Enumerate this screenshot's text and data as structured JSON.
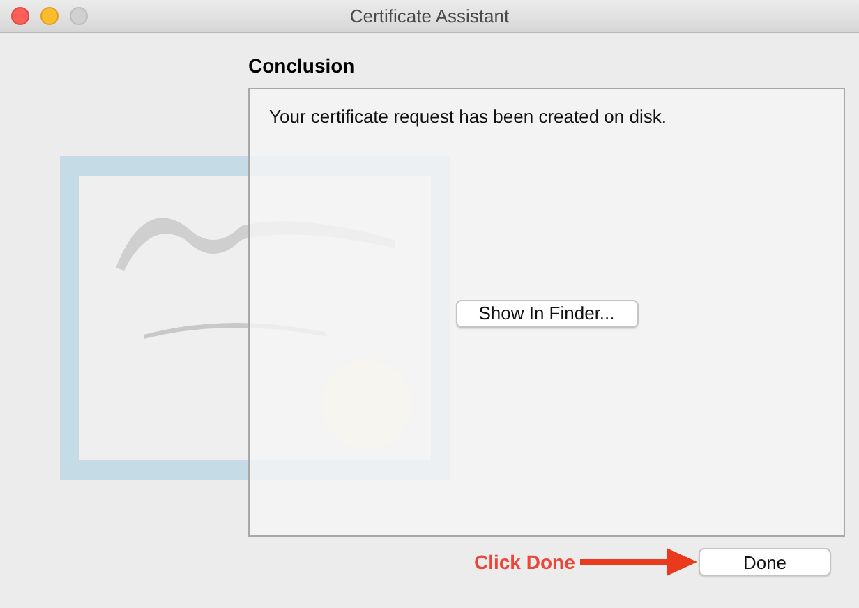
{
  "window": {
    "title": "Certificate Assistant",
    "traffic_lights": [
      {
        "kind": "close",
        "disabled": false
      },
      {
        "kind": "minimize",
        "disabled": false
      },
      {
        "kind": "zoom",
        "disabled": true
      }
    ]
  },
  "heading": "Conclusion",
  "message": "Your certificate request has been created on disk.",
  "finder_button": {
    "label": "Show In Finder..."
  },
  "annotation": {
    "text": "Click Done"
  },
  "done_button": {
    "label": "Done"
  }
}
